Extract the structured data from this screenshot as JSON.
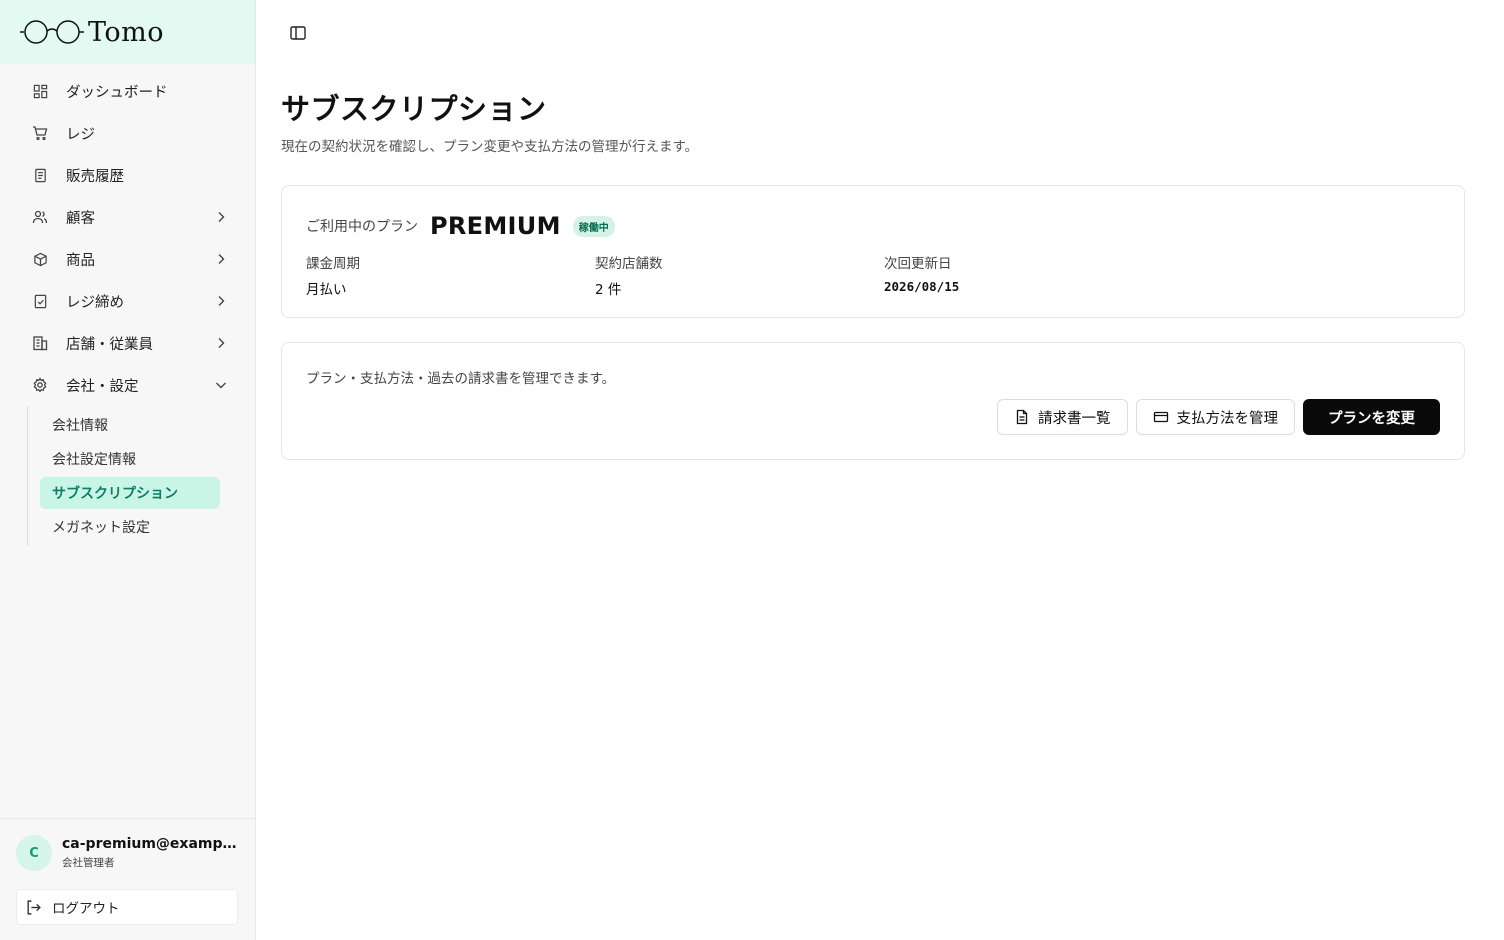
{
  "brand": {
    "name": "Tomo"
  },
  "sidebar": {
    "items": [
      {
        "label": "ダッシュボード",
        "icon": "dashboard-icon"
      },
      {
        "label": "レジ",
        "icon": "cart-icon"
      },
      {
        "label": "販売履歴",
        "icon": "receipt-icon"
      },
      {
        "label": "顧客",
        "icon": "users-icon",
        "chevron": "right"
      },
      {
        "label": "商品",
        "icon": "package-icon",
        "chevron": "right"
      },
      {
        "label": "レジ締め",
        "icon": "clipboard-check-icon",
        "chevron": "right"
      },
      {
        "label": "店舗・従業員",
        "icon": "building-icon",
        "chevron": "right"
      },
      {
        "label": "会社・設定",
        "icon": "gear-icon",
        "chevron": "down"
      }
    ],
    "subitems": [
      {
        "label": "会社情報"
      },
      {
        "label": "会社設定情報"
      },
      {
        "label": "サブスクリプション",
        "active": true
      },
      {
        "label": "メガネット設定"
      }
    ]
  },
  "user": {
    "avatar_initial": "C",
    "email": "ca-premium@example.com",
    "role": "会社管理者",
    "logout_label": "ログアウト"
  },
  "page": {
    "title": "サブスクリプション",
    "description": "現在の契約状況を確認し、プラン変更や支払方法の管理が行えます。"
  },
  "plan": {
    "label": "ご利用中のプラン",
    "name": "PREMIUM",
    "status": "稼働中",
    "stats": [
      {
        "label": "課金周期",
        "value": "月払い"
      },
      {
        "label": "契約店舗数",
        "value": "2 件"
      },
      {
        "label": "次回更新日",
        "value": "2026/08/15"
      }
    ]
  },
  "manage": {
    "text": "プラン・支払方法・過去の請求書を管理できます。",
    "invoices_label": "請求書一覧",
    "payment_label": "支払方法を管理",
    "change_plan_label": "プランを変更"
  },
  "colors": {
    "accent": "#0f7c66",
    "brand_bg": "#e3faf3",
    "active_bg": "#c8f5e6",
    "primary_button": "#0a0a0a"
  }
}
